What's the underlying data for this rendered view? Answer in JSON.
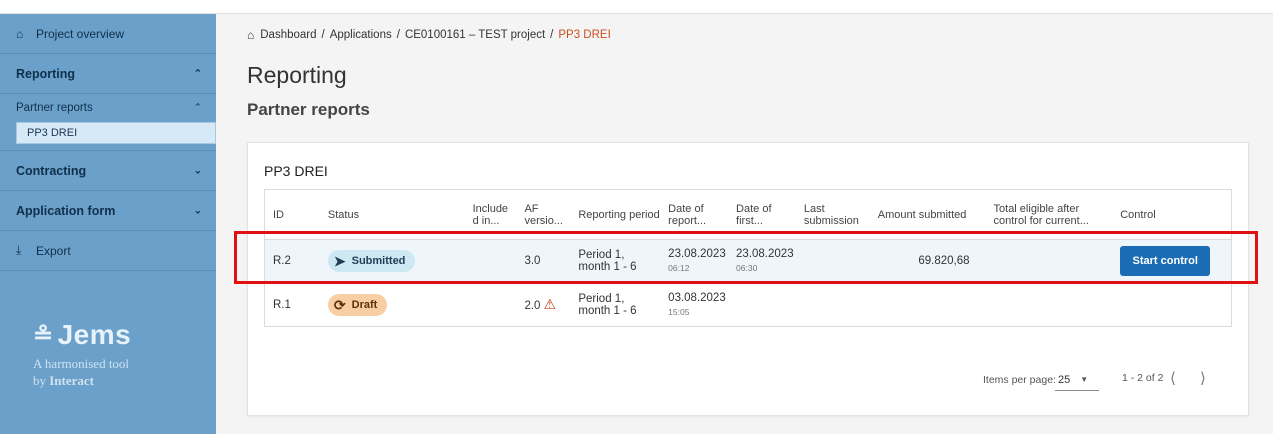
{
  "sidebar": {
    "project_overview": "Project overview",
    "reporting": "Reporting",
    "partner_reports": "Partner reports",
    "pp3_drei": "PP3 DREI",
    "contracting": "Contracting",
    "application_form": "Application form",
    "export": "Export",
    "logo_brand": "Jems",
    "logo_tag_line1": "A harmonised tool",
    "logo_tag_by": "by",
    "logo_tag_org": "Interact"
  },
  "breadcrumb": {
    "items": [
      "Dashboard",
      "Applications",
      "CE0100161 – TEST project",
      "PP3 DREI"
    ],
    "separator": "/"
  },
  "page": {
    "title": "Reporting",
    "subtitle": "Partner reports"
  },
  "card": {
    "title": "PP3 DREI"
  },
  "table": {
    "headers": {
      "id": "ID",
      "status": "Status",
      "include": "Include d in...",
      "af_version": "AF versio...",
      "reporting_period": "Reporting period",
      "date_of_report": "Date of report...",
      "date_of_first": "Date of first...",
      "last_submission": "Last submission",
      "amount_submitted": "Amount submitted",
      "total_eligible": "Total eligible after control for current...",
      "control": "Control"
    },
    "rows": [
      {
        "id": "R.2",
        "status": "Submitted",
        "af_version": "3.0",
        "period_line1": "Period 1,",
        "period_line2": "month 1 - 6",
        "report_date": "23.08.2023",
        "report_time": "06:12",
        "first_date": "23.08.2023",
        "first_time": "06:30",
        "amount": "69.820,68",
        "control_button": "Start control"
      },
      {
        "id": "R.1",
        "status": "Draft",
        "af_version": "2.0",
        "period_line1": "Period 1,",
        "period_line2": "month 1 - 6",
        "report_date": "03.08.2023",
        "report_time": "15:05"
      }
    ]
  },
  "pagination": {
    "items_per_page_label": "Items per page:",
    "items_per_page_value": "25",
    "range": "1 - 2 of 2"
  },
  "colors": {
    "sidebar_bg": "#6aa0c9",
    "submitted_chip": "#cde7f3",
    "draft_chip": "#f8cfa4",
    "primary_button": "#1a6cb5",
    "breadcrumb_current": "#c8501f",
    "highlight_border": "#e01010"
  },
  "icons": {
    "home": "home-icon",
    "chevron_up": "chevron-up-icon",
    "chevron_down": "chevron-down-icon",
    "download": "download-icon",
    "submitted": "send-arrow-icon",
    "draft": "draft-circle-icon",
    "warning": "warning-triangle-icon"
  }
}
